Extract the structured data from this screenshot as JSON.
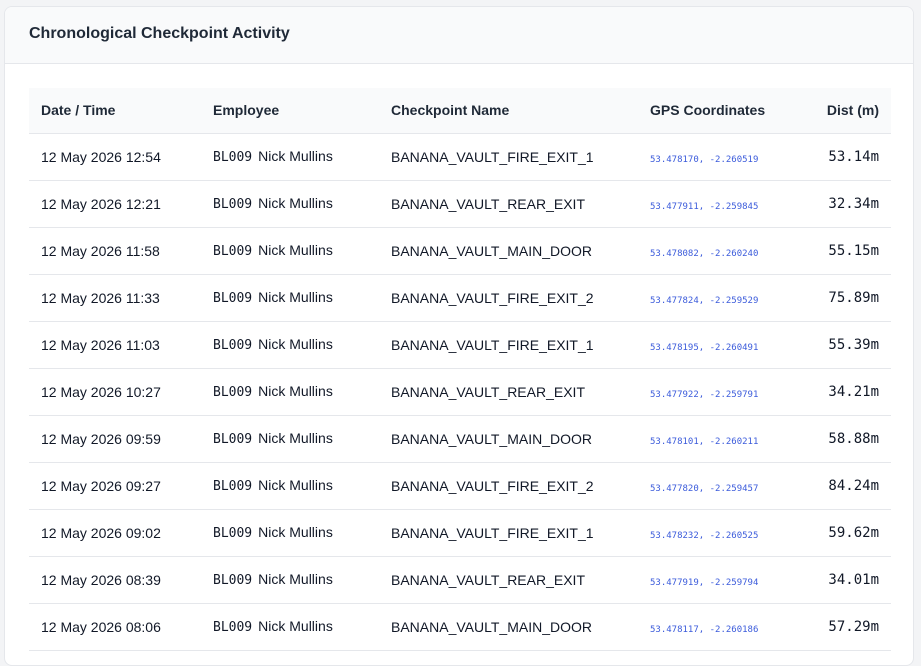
{
  "header": {
    "title": "Chronological Checkpoint Activity"
  },
  "table": {
    "columns": [
      "Date / Time",
      "Employee",
      "Checkpoint Name",
      "GPS Coordinates",
      "Dist (m)"
    ],
    "rows": [
      {
        "datetime": "12 May 2026 12:54",
        "emp_code": "BL009",
        "emp_name": "Nick Mullins",
        "checkpoint": "BANANA_VAULT_FIRE_EXIT_1",
        "gps": "53.478170, -2.260519",
        "dist": "53.14m"
      },
      {
        "datetime": "12 May 2026 12:21",
        "emp_code": "BL009",
        "emp_name": "Nick Mullins",
        "checkpoint": "BANANA_VAULT_REAR_EXIT",
        "gps": "53.477911, -2.259845",
        "dist": "32.34m"
      },
      {
        "datetime": "12 May 2026 11:58",
        "emp_code": "BL009",
        "emp_name": "Nick Mullins",
        "checkpoint": "BANANA_VAULT_MAIN_DOOR",
        "gps": "53.478082, -2.260240",
        "dist": "55.15m"
      },
      {
        "datetime": "12 May 2026 11:33",
        "emp_code": "BL009",
        "emp_name": "Nick Mullins",
        "checkpoint": "BANANA_VAULT_FIRE_EXIT_2",
        "gps": "53.477824, -2.259529",
        "dist": "75.89m"
      },
      {
        "datetime": "12 May 2026 11:03",
        "emp_code": "BL009",
        "emp_name": "Nick Mullins",
        "checkpoint": "BANANA_VAULT_FIRE_EXIT_1",
        "gps": "53.478195, -2.260491",
        "dist": "55.39m"
      },
      {
        "datetime": "12 May 2026 10:27",
        "emp_code": "BL009",
        "emp_name": "Nick Mullins",
        "checkpoint": "BANANA_VAULT_REAR_EXIT",
        "gps": "53.477922, -2.259791",
        "dist": "34.21m"
      },
      {
        "datetime": "12 May 2026 09:59",
        "emp_code": "BL009",
        "emp_name": "Nick Mullins",
        "checkpoint": "BANANA_VAULT_MAIN_DOOR",
        "gps": "53.478101, -2.260211",
        "dist": "58.88m"
      },
      {
        "datetime": "12 May 2026 09:27",
        "emp_code": "BL009",
        "emp_name": "Nick Mullins",
        "checkpoint": "BANANA_VAULT_FIRE_EXIT_2",
        "gps": "53.477820, -2.259457",
        "dist": "84.24m"
      },
      {
        "datetime": "12 May 2026 09:02",
        "emp_code": "BL009",
        "emp_name": "Nick Mullins",
        "checkpoint": "BANANA_VAULT_FIRE_EXIT_1",
        "gps": "53.478232, -2.260525",
        "dist": "59.62m"
      },
      {
        "datetime": "12 May 2026 08:39",
        "emp_code": "BL009",
        "emp_name": "Nick Mullins",
        "checkpoint": "BANANA_VAULT_REAR_EXIT",
        "gps": "53.477919, -2.259794",
        "dist": "34.01m"
      },
      {
        "datetime": "12 May 2026 08:06",
        "emp_code": "BL009",
        "emp_name": "Nick Mullins",
        "checkpoint": "BANANA_VAULT_MAIN_DOOR",
        "gps": "53.478117, -2.260186",
        "dist": "57.29m"
      }
    ]
  },
  "colors": {
    "page_bg": "#f3f4f6",
    "card_bg": "#ffffff",
    "header_bg": "#f9fafb",
    "border": "#e5e7eb",
    "gps_text": "#3b5bdb"
  }
}
